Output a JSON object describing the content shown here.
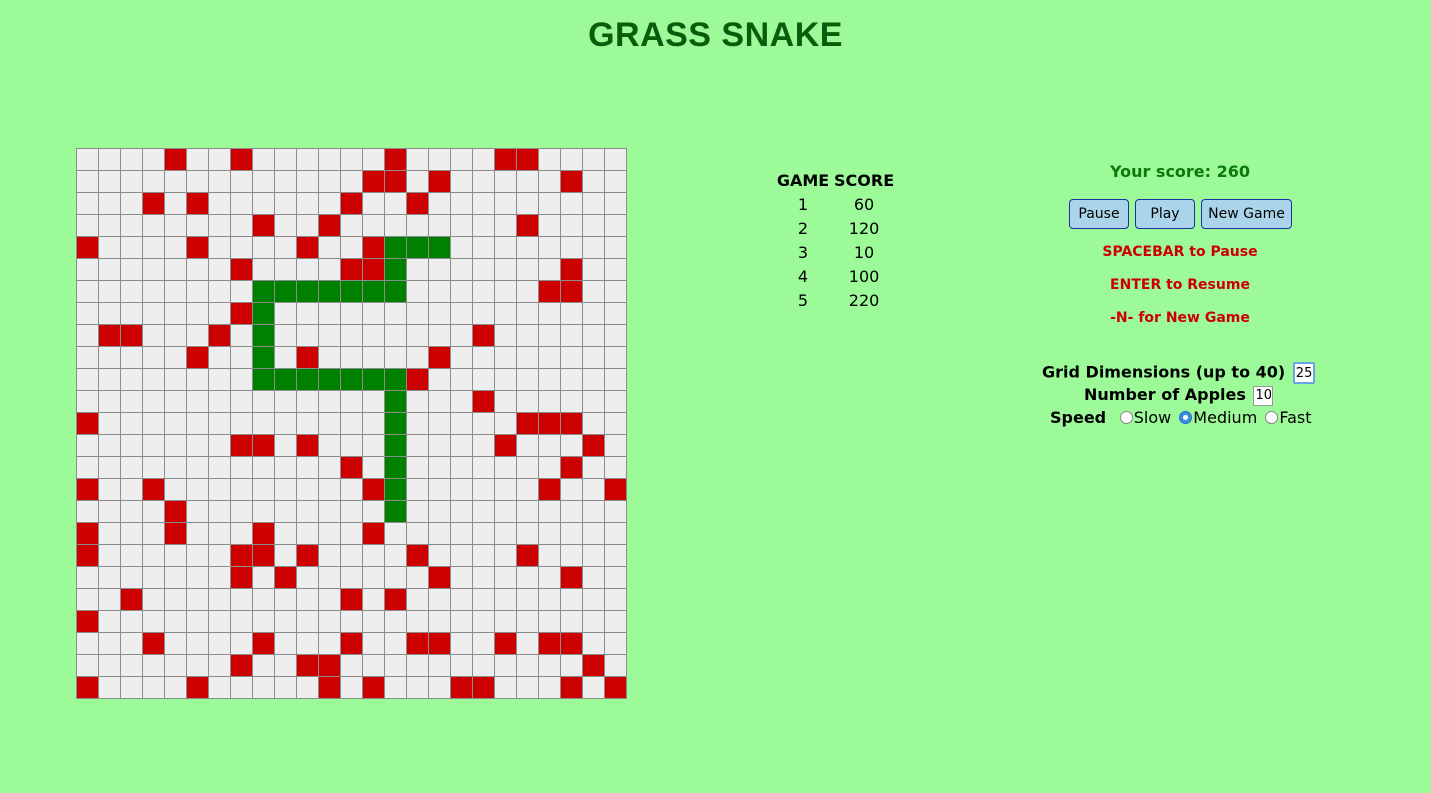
{
  "title": "GRASS SNAKE",
  "board": {
    "size": 25,
    "apples": [
      [
        0,
        4
      ],
      [
        0,
        7
      ],
      [
        0,
        14
      ],
      [
        0,
        19
      ],
      [
        0,
        20
      ],
      [
        1,
        13
      ],
      [
        1,
        14
      ],
      [
        1,
        16
      ],
      [
        1,
        22
      ],
      [
        2,
        3
      ],
      [
        2,
        5
      ],
      [
        2,
        12
      ],
      [
        2,
        15
      ],
      [
        3,
        8
      ],
      [
        3,
        11
      ],
      [
        3,
        20
      ],
      [
        4,
        0
      ],
      [
        4,
        5
      ],
      [
        4,
        10
      ],
      [
        4,
        13
      ],
      [
        5,
        7
      ],
      [
        5,
        12
      ],
      [
        5,
        13
      ],
      [
        5,
        22
      ],
      [
        6,
        21
      ],
      [
        6,
        22
      ],
      [
        7,
        7
      ],
      [
        8,
        1
      ],
      [
        8,
        2
      ],
      [
        8,
        6
      ],
      [
        8,
        18
      ],
      [
        9,
        5
      ],
      [
        9,
        10
      ],
      [
        9,
        16
      ],
      [
        10,
        15
      ],
      [
        11,
        18
      ],
      [
        12,
        0
      ],
      [
        12,
        20
      ],
      [
        12,
        21
      ],
      [
        12,
        22
      ],
      [
        13,
        7
      ],
      [
        13,
        8
      ],
      [
        13,
        10
      ],
      [
        13,
        19
      ],
      [
        13,
        23
      ],
      [
        14,
        12
      ],
      [
        14,
        22
      ],
      [
        15,
        0
      ],
      [
        15,
        3
      ],
      [
        15,
        13
      ],
      [
        15,
        21
      ],
      [
        15,
        24
      ],
      [
        16,
        4
      ],
      [
        17,
        0
      ],
      [
        17,
        4
      ],
      [
        17,
        8
      ],
      [
        17,
        13
      ],
      [
        18,
        0
      ],
      [
        18,
        7
      ],
      [
        18,
        8
      ],
      [
        18,
        10
      ],
      [
        18,
        15
      ],
      [
        18,
        20
      ],
      [
        19,
        7
      ],
      [
        19,
        9
      ],
      [
        19,
        16
      ],
      [
        19,
        22
      ],
      [
        20,
        2
      ],
      [
        20,
        12
      ],
      [
        20,
        14
      ],
      [
        21,
        0
      ],
      [
        22,
        3
      ],
      [
        22,
        8
      ],
      [
        22,
        12
      ],
      [
        22,
        15
      ],
      [
        22,
        16
      ],
      [
        22,
        19
      ],
      [
        22,
        21
      ],
      [
        22,
        22
      ],
      [
        23,
        7
      ],
      [
        23,
        10
      ],
      [
        23,
        11
      ],
      [
        23,
        23
      ],
      [
        24,
        0
      ],
      [
        24,
        5
      ],
      [
        24,
        11
      ],
      [
        24,
        13
      ],
      [
        24,
        17
      ],
      [
        24,
        18
      ],
      [
        24,
        22
      ],
      [
        24,
        24
      ]
    ],
    "snake": [
      [
        4,
        16
      ],
      [
        4,
        15
      ],
      [
        4,
        14
      ],
      [
        5,
        14
      ],
      [
        6,
        14
      ],
      [
        6,
        13
      ],
      [
        6,
        12
      ],
      [
        6,
        11
      ],
      [
        6,
        10
      ],
      [
        6,
        9
      ],
      [
        6,
        8
      ],
      [
        7,
        8
      ],
      [
        8,
        8
      ],
      [
        9,
        8
      ],
      [
        10,
        8
      ],
      [
        10,
        9
      ],
      [
        10,
        10
      ],
      [
        10,
        11
      ],
      [
        10,
        12
      ],
      [
        10,
        13
      ],
      [
        10,
        14
      ],
      [
        11,
        14
      ],
      [
        12,
        14
      ],
      [
        13,
        14
      ],
      [
        14,
        14
      ],
      [
        15,
        14
      ],
      [
        16,
        14
      ]
    ]
  },
  "scoreboard": {
    "headers": [
      "GAME",
      "SCORE"
    ],
    "rows": [
      [
        "1",
        "60"
      ],
      [
        "2",
        "120"
      ],
      [
        "3",
        "10"
      ],
      [
        "4",
        "100"
      ],
      [
        "5",
        "220"
      ]
    ]
  },
  "panel": {
    "your_score": "Your score: 260",
    "buttons": {
      "pause": "Pause",
      "play": "Play",
      "new_game": "New Game"
    },
    "hints": {
      "pause": "SPACEBAR to Pause",
      "resume": "ENTER to Resume",
      "new_game": "-N- for New Game"
    },
    "settings": {
      "grid_label": "Grid Dimensions (up to 40)",
      "grid_value": "25",
      "apples_label": "Number of Apples",
      "apples_value": "10",
      "speed_label": "Speed",
      "speed_options": [
        "Slow",
        "Medium",
        "Fast"
      ],
      "speed_selected": "Medium"
    }
  },
  "colors": {
    "background": "#9cfa98",
    "apple": "#cc0000",
    "snake": "#008000",
    "empty_cell": "#eeeeee"
  }
}
